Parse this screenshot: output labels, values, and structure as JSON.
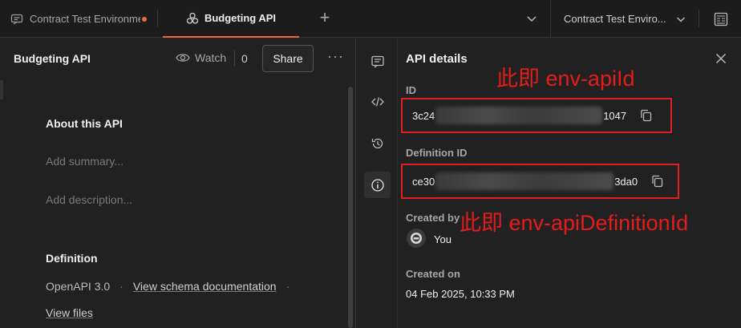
{
  "tabs": {
    "tab1_label": "Contract Test Environme",
    "tab2_label": "Budgeting API",
    "new_tab_symbol": "+"
  },
  "environment": {
    "selected": "Contract Test Enviro..."
  },
  "left_pane": {
    "api_name": "Budgeting API",
    "watch_label": "Watch",
    "watch_count": "0",
    "share_label": "Share",
    "more_symbol": "···",
    "about_title": "About this API",
    "summary_placeholder": "Add summary...",
    "description_placeholder": "Add description...",
    "definition_title": "Definition",
    "definition_type": "OpenAPI 3.0",
    "separator": "·",
    "schema_link": "View schema documentation",
    "view_files": "View files"
  },
  "details": {
    "title": "API details",
    "id_label": "ID",
    "id_prefix": "3c24",
    "id_suffix": "1047",
    "definition_id_label": "Definition ID",
    "definition_id_prefix": "ce30",
    "definition_id_suffix": "3da0",
    "created_by_label": "Created by",
    "created_by_value": "You",
    "created_on_label": "Created on",
    "created_on_value": "04 Feb 2025, 10:33 PM"
  },
  "annotations": {
    "api_id": "此即 env-apiId",
    "api_definition_id": "此即 env-apiDefinitionId"
  },
  "icons": {
    "tab1": "request-icon",
    "tab2": "api-icon",
    "rail": [
      "comments-icon",
      "code-icon",
      "history-icon",
      "info-icon"
    ]
  },
  "colors": {
    "accent": "#f26b3a",
    "annotation": "#e02020",
    "background": "#212121"
  }
}
